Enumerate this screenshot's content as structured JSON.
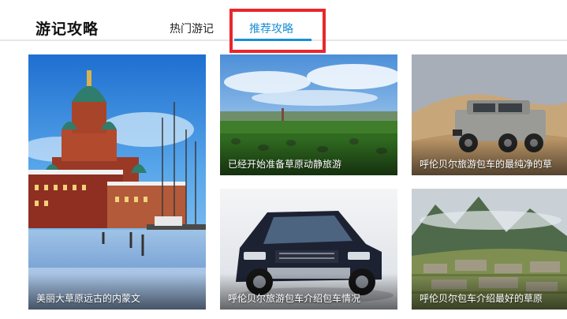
{
  "header": {
    "title": "游记攻略",
    "tabs": [
      {
        "label": "热门游记",
        "active": false
      },
      {
        "label": "推荐攻略",
        "active": true
      }
    ],
    "accent_color": "#1a8fd6",
    "highlight_color": "#e8272b"
  },
  "cards": [
    {
      "caption": "美丽大草原远古的内蒙文",
      "image": "snowy-harbor-cathedral"
    },
    {
      "caption": "已经开始准备草原动静旅游",
      "image": "green-grassland-horizon"
    },
    {
      "caption": "呼伦贝尔旅游包车的最纯净的草",
      "image": "silver-offroad-suv-desert"
    },
    {
      "caption": "呼伦贝尔旅游包车介绍包车情况",
      "image": "dark-blue-suv"
    },
    {
      "caption": "呼伦贝尔包车介绍最好的草原",
      "image": "mountain-ruins-terraces"
    }
  ]
}
